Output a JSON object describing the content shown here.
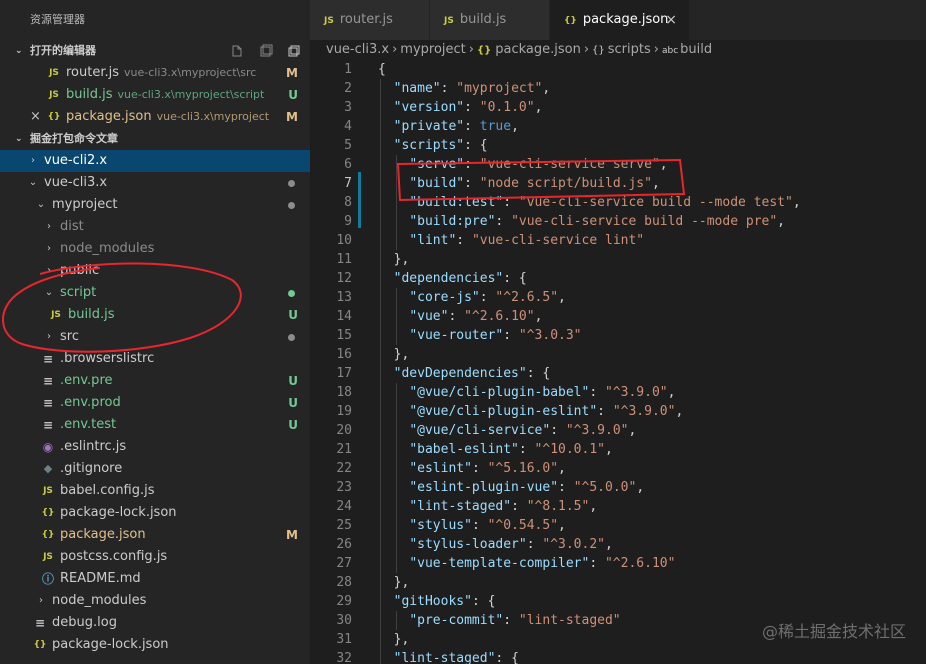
{
  "sidebar": {
    "title": "资源管理器",
    "open_editors": {
      "label": "打开的编辑器",
      "items": [
        {
          "icon": "JS",
          "name": "router.js",
          "path": "vue-cli3.x\\myproject\\src",
          "status": "M"
        },
        {
          "icon": "JS",
          "name": "build.js",
          "path": "vue-cli3.x\\myproject\\script",
          "status": "U"
        },
        {
          "icon": "{}",
          "name": "package.json",
          "path": "vue-cli3.x\\myproject",
          "status": "M",
          "close": "×"
        }
      ]
    },
    "workspace": {
      "label": "掘金打包命令文章",
      "items": [
        {
          "chev": "›",
          "name": "vue-cli2.x",
          "selected": true
        },
        {
          "chev": "⌄",
          "name": "vue-cli3.x"
        },
        {
          "chev": "⌄",
          "name": "myproject"
        },
        {
          "chev": "›",
          "name": "dist"
        },
        {
          "chev": "›",
          "name": "node_modules"
        },
        {
          "chev": "›",
          "name": "public"
        },
        {
          "chev": "⌄",
          "name": "script"
        },
        {
          "icon": "JS",
          "name": "build.js",
          "status": "U"
        },
        {
          "chev": "›",
          "name": "src"
        },
        {
          "icon": "≡",
          "name": ".browserslistrc"
        },
        {
          "icon": "≡",
          "name": ".env.pre",
          "status": "U"
        },
        {
          "icon": "≡",
          "name": ".env.prod",
          "status": "U"
        },
        {
          "icon": "≡",
          "name": ".env.test",
          "status": "U"
        },
        {
          "icon": "◉",
          "name": ".eslintrc.js"
        },
        {
          "icon": "◆",
          "name": ".gitignore"
        },
        {
          "icon": "JS",
          "name": "babel.config.js"
        },
        {
          "icon": "{}",
          "name": "package-lock.json"
        },
        {
          "icon": "{}",
          "name": "package.json",
          "status": "M"
        },
        {
          "icon": "JS",
          "name": "postcss.config.js"
        },
        {
          "icon": "ⓘ",
          "name": "README.md"
        },
        {
          "chev": "›",
          "name": "node_modules"
        },
        {
          "icon": "≡",
          "name": "debug.log"
        },
        {
          "icon": "{}",
          "name": "package-lock.json"
        }
      ]
    }
  },
  "tabs": [
    {
      "icon": "JS",
      "label": "router.js"
    },
    {
      "icon": "JS",
      "label": "build.js"
    },
    {
      "icon": "{}",
      "label": "package.json",
      "close": "×",
      "active": true
    }
  ],
  "breadcrumb": {
    "parts": [
      "vue-cli3.x",
      "myproject",
      "package.json",
      "scripts",
      "build"
    ],
    "icons": [
      "{}",
      "{}",
      "abc"
    ]
  },
  "editor": {
    "line_numbers": [
      "1",
      "2",
      "3",
      "4",
      "5",
      "6",
      "7",
      "8",
      "9",
      "10",
      "11",
      "12",
      "13",
      "14",
      "15",
      "16",
      "17",
      "18",
      "19",
      "20",
      "21",
      "22",
      "23",
      "24",
      "25",
      "26",
      "27",
      "28",
      "29",
      "30",
      "31",
      "32"
    ],
    "lines": [
      "{",
      "  \"name\": \"myproject\",",
      "  \"version\": \"0.1.0\",",
      "  \"private\": true,",
      "  \"scripts\": {",
      "    \"serve\": \"vue-cli-service serve\",",
      "    \"build\": \"node script/build.js\",",
      "    \"build:test\": \"vue-cli-service build --mode test\",",
      "    \"build:pre\": \"vue-cli-service build --mode pre\",",
      "    \"lint\": \"vue-cli-service lint\"",
      "  },",
      "  \"dependencies\": {",
      "    \"core-js\": \"^2.6.5\",",
      "    \"vue\": \"^2.6.10\",",
      "    \"vue-router\": \"^3.0.3\"",
      "  },",
      "  \"devDependencies\": {",
      "    \"@vue/cli-plugin-babel\": \"^3.9.0\",",
      "    \"@vue/cli-plugin-eslint\": \"^3.9.0\",",
      "    \"@vue/cli-service\": \"^3.9.0\",",
      "    \"babel-eslint\": \"^10.0.1\",",
      "    \"eslint\": \"^5.16.0\",",
      "    \"eslint-plugin-vue\": \"^5.0.0\",",
      "    \"lint-staged\": \"^8.1.5\",",
      "    \"stylus\": \"^0.54.5\",",
      "    \"stylus-loader\": \"^3.0.2\",",
      "    \"vue-template-compiler\": \"^2.6.10\"",
      "  },",
      "  \"gitHooks\": {",
      "    \"pre-commit\": \"lint-staged\"",
      "  },",
      "  \"lint-staged\": {"
    ]
  },
  "watermark": "@稀土掘金技术社区",
  "colors": {
    "accent_selected": "#094771",
    "modified": "#e2c08d",
    "untracked": "#73c991",
    "annotation_red": "#e8262d"
  }
}
